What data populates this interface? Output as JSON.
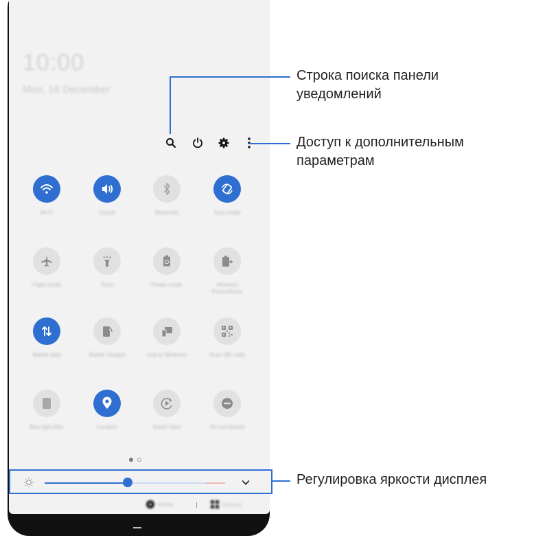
{
  "panel": {
    "clock": "10:00",
    "date": "Mon, 16 December",
    "top_icons": [
      "search-icon",
      "power-icon",
      "gear-icon",
      "more-vertical-icon"
    ],
    "tiles": [
      {
        "label": "Wi-Fi",
        "icon": "wifi-icon",
        "on": true
      },
      {
        "label": "Sound",
        "icon": "sound-icon",
        "on": true
      },
      {
        "label": "Bluetooth",
        "icon": "bluetooth-icon",
        "on": false
      },
      {
        "label": "Auto rotate",
        "icon": "auto-rotate-icon",
        "on": true
      },
      {
        "label": "Flight mode",
        "icon": "airplane-icon",
        "on": false
      },
      {
        "label": "Torch",
        "icon": "torch-icon",
        "on": false
      },
      {
        "label": "Power mode",
        "icon": "battery-icon",
        "on": false
      },
      {
        "label": "Wireless PowerShare",
        "icon": "powershare-icon",
        "on": false
      },
      {
        "label": "Mobile data",
        "icon": "mobile-data-icon",
        "on": true
      },
      {
        "label": "Mobile Hotspot",
        "icon": "hotspot-icon",
        "on": false
      },
      {
        "label": "Link to Windows",
        "icon": "link-windows-icon",
        "on": false
      },
      {
        "label": "Scan QR code",
        "icon": "qr-icon",
        "on": false
      },
      {
        "label": "Blue light filter",
        "icon": "blue-light-icon",
        "on": false
      },
      {
        "label": "Location",
        "icon": "location-icon",
        "on": true
      },
      {
        "label": "Smart View",
        "icon": "smart-view-icon",
        "on": false
      },
      {
        "label": "Do not disturb",
        "icon": "dnd-icon",
        "on": false
      }
    ],
    "page_indicator": {
      "pages": 2,
      "current": 1
    },
    "brightness": {
      "level": 0.38
    },
    "media_label": "Media",
    "devices_label": "Devices"
  },
  "callouts": {
    "search": "Строка поиска панели уведомлений",
    "search_line1": "Строка поиска панели",
    "search_line2": "уведомлений",
    "more_line1": "Доступ к дополнительным",
    "more_line2": "параметрам",
    "brightness": "Регулировка яркости дисплея"
  },
  "colors": {
    "accent": "#2e6fd1",
    "tile_off": "#e1e1e1",
    "panel_bg": "#f2f2f2"
  }
}
